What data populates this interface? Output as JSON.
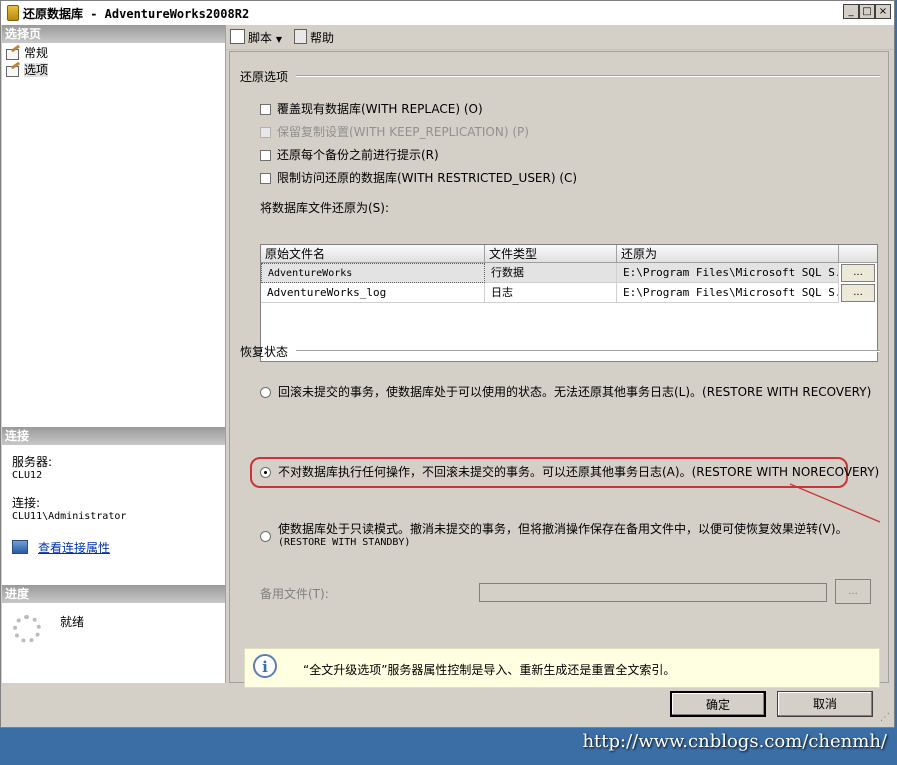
{
  "window": {
    "title": "还原数据库 - AdventureWorks2008R2",
    "minimize": "_",
    "maximize": "□",
    "close": "×"
  },
  "left_panel": {
    "select_page_header": "选择页",
    "pages": [
      {
        "label": "常规",
        "icon": "page-icon"
      },
      {
        "label": "选项",
        "icon": "page-icon",
        "selected": true
      }
    ],
    "connection_header": "连接",
    "server_label": "服务器:",
    "server_value": "CLU12",
    "connection_label": "连接:",
    "connection_value": "CLU11\\Administrator",
    "view_connection_link": "查看连接属性",
    "progress_header": "进度",
    "progress_status": "就绪"
  },
  "toolbar": {
    "script_label": "脚本",
    "help_label": "帮助"
  },
  "restore_options": {
    "group_label": "还原选项",
    "checkboxes": [
      {
        "label": "覆盖现有数据库(WITH REPLACE) (O)",
        "checked": false,
        "enabled": true
      },
      {
        "label": "保留复制设置(WITH KEEP_REPLICATION) (P)",
        "checked": false,
        "enabled": false
      },
      {
        "label": "还原每个备份之前进行提示(R)",
        "checked": false,
        "enabled": true
      },
      {
        "label": "限制访问还原的数据库(WITH RESTRICTED_USER) (C)",
        "checked": false,
        "enabled": true
      }
    ],
    "restore_as_label": "将数据库文件还原为(S):",
    "columns": [
      "原始文件名",
      "文件类型",
      "还原为"
    ],
    "rows": [
      {
        "original": "AdventureWorks",
        "type": "行数据",
        "restore_as": "E:\\Program Files\\Microsoft SQL S...",
        "button": "..."
      },
      {
        "original": "AdventureWorks_log",
        "type": "日志",
        "restore_as": "E:\\Program Files\\Microsoft SQL S...",
        "button": "..."
      }
    ]
  },
  "recovery_state": {
    "group_label": "恢复状态",
    "options": [
      {
        "label": "回滚未提交的事务，使数据库处于可以使用的状态。无法还原其他事务日志(L)。(RESTORE WITH RECOVERY)",
        "selected": false
      },
      {
        "label": "不对数据库执行任何操作，不回滚未提交的事务。可以还原其他事务日志(A)。(RESTORE WITH NORECOVERY)",
        "selected": true
      },
      {
        "label": "使数据库处于只读模式。撤消未提交的事务，但将撤消操作保存在备用文件中，以便可使恢复效果逆转(V)。",
        "label2": "(RESTORE WITH STANDBY)",
        "selected": false
      }
    ],
    "standby_file_label": "备用文件(T):",
    "standby_file_value": "",
    "standby_browse": "..."
  },
  "info": {
    "icon": "info-icon",
    "text": "“全文升级选项”服务器属性控制是导入、重新生成还是重置全文索引。"
  },
  "buttons": {
    "ok": "确定",
    "cancel": "取消"
  },
  "watermark": "http://www.cnblogs.com/chenmh/",
  "colors": {
    "highlight": "#cc3333",
    "desktop": "#3a6ea5",
    "info_bg": "#ffffe1"
  }
}
